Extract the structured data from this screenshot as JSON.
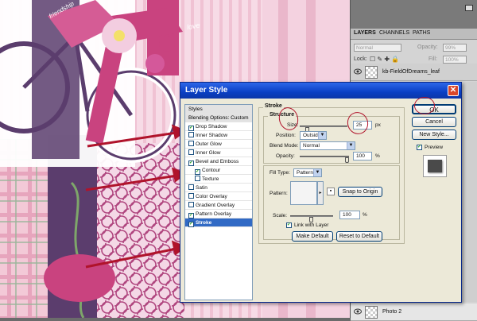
{
  "artwork": {
    "handwriting": [
      "love",
      "friendship"
    ]
  },
  "layers_panel": {
    "tabs": [
      "LAYERS",
      "CHANNELS",
      "PATHS"
    ],
    "blend_mode": "Normal",
    "opacity_label": "Opacity:",
    "opacity_value": "99%",
    "lock_label": "Lock:",
    "fill_label": "Fill:",
    "fill_value": "100%",
    "layers": [
      "kb-FieldOfDreams_leaf",
      "Photo 2"
    ]
  },
  "dialog": {
    "title": "Layer Style",
    "close_glyph": "✕",
    "styles_list": [
      {
        "label": "Styles",
        "type": "header"
      },
      {
        "label": "Blending Options: Custom",
        "type": "header"
      },
      {
        "label": "Drop Shadow",
        "checked": true
      },
      {
        "label": "Inner Shadow",
        "checked": false
      },
      {
        "label": "Outer Glow",
        "checked": false
      },
      {
        "label": "Inner Glow",
        "checked": false
      },
      {
        "label": "Bevel and Emboss",
        "checked": true
      },
      {
        "label": "Contour",
        "checked": true,
        "indent": true
      },
      {
        "label": "Texture",
        "checked": false,
        "indent": true
      },
      {
        "label": "Satin",
        "checked": false
      },
      {
        "label": "Color Overlay",
        "checked": false
      },
      {
        "label": "Gradient Overlay",
        "checked": false
      },
      {
        "label": "Pattern Overlay",
        "checked": true
      },
      {
        "label": "Stroke",
        "checked": true,
        "active": true
      }
    ],
    "stroke": {
      "section_title": "Stroke",
      "structure_title": "Structure",
      "size_label": "Size:",
      "size_value": "25",
      "size_unit": "px",
      "position_label": "Position:",
      "position_value": "Outside",
      "blend_mode_label": "Blend Mode:",
      "blend_mode_value": "Normal",
      "opacity_label": "Opacity:",
      "opacity_value": "100",
      "opacity_unit": "%",
      "fill_type_label": "Fill Type:",
      "fill_type_value": "Pattern",
      "pattern_label": "Pattern:",
      "snap_button": "Snap to Origin",
      "scale_label": "Scale:",
      "scale_value": "100",
      "scale_unit": "%",
      "link_label": "Link with Layer",
      "link_checked": true,
      "make_default": "Make Default",
      "reset_default": "Reset to Default"
    },
    "buttons": {
      "ok": "OK",
      "cancel": "Cancel",
      "new_style": "New Style...",
      "preview_label": "Preview",
      "preview_checked": true
    }
  },
  "colors": {
    "annotation": "#b0132b",
    "selection": "#316ac5",
    "title_bar": "#0a3fc4",
    "art_pink": "#c9437f",
    "art_plum": "#5b3d6d"
  }
}
